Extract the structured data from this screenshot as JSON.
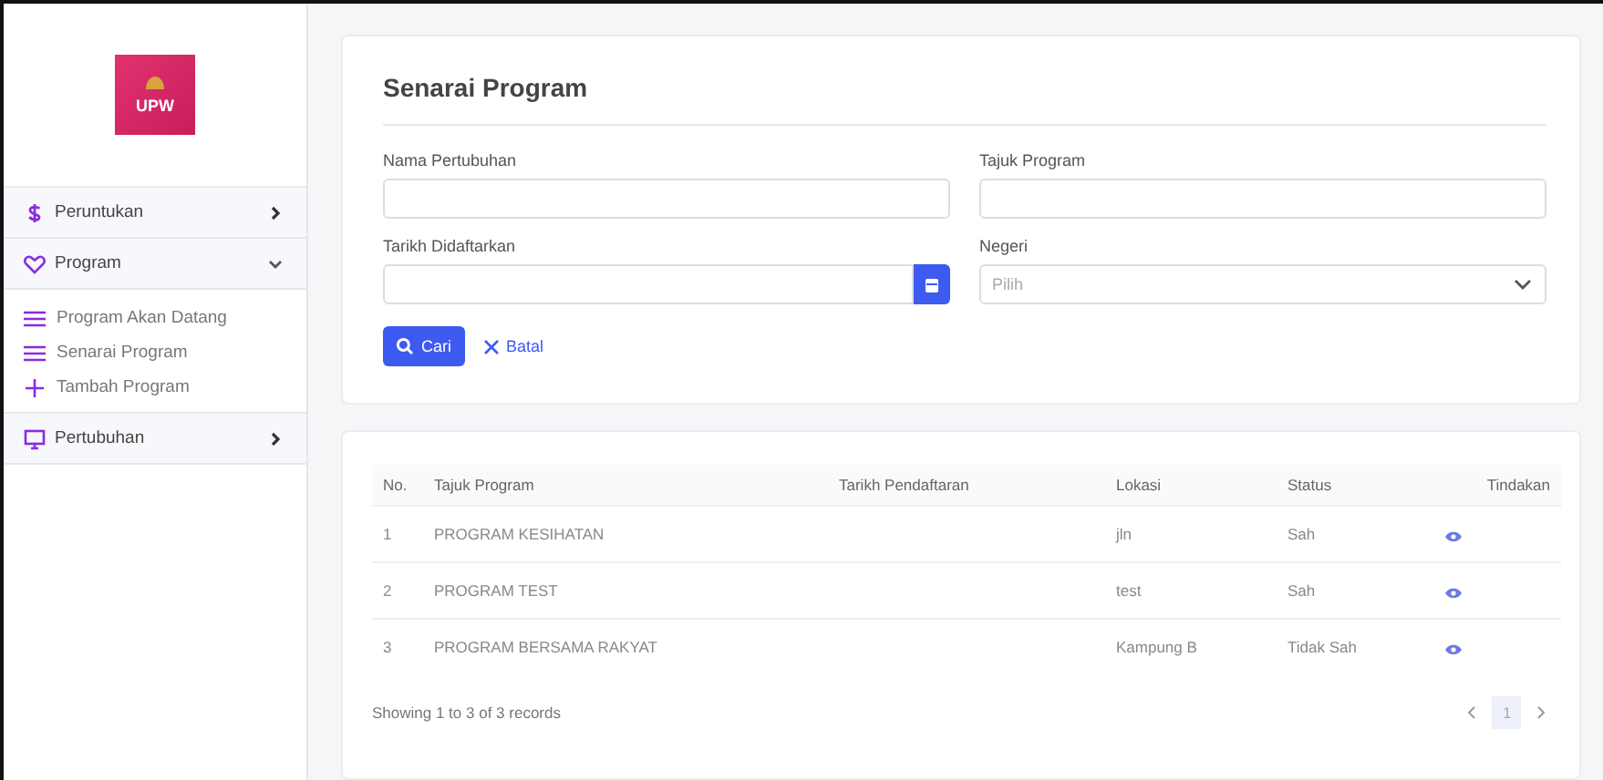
{
  "logo": {
    "text": "UPW"
  },
  "sidebar": {
    "items": [
      {
        "kind": "section",
        "label": "Peruntukan",
        "expanded": false
      },
      {
        "kind": "section",
        "label": "Program",
        "expanded": true,
        "children": [
          {
            "label": "Program Akan Datang"
          },
          {
            "label": "Senarai Program"
          },
          {
            "label": "Tambah Program"
          }
        ]
      },
      {
        "kind": "section",
        "label": "Pertubuhan",
        "expanded": false
      }
    ]
  },
  "search_card": {
    "title": "Senarai Program",
    "fields": [
      {
        "kind": "text",
        "label": "Nama Pertubuhan"
      },
      {
        "kind": "text",
        "label": "Tajuk Program"
      },
      {
        "kind": "date",
        "label": "Tarikh Didaftarkan"
      },
      {
        "kind": "select",
        "label": "Negeri",
        "placeholder": "Pilih"
      }
    ],
    "search_button": "Cari",
    "cancel_link": "Batal"
  },
  "table": {
    "columns": [
      "No.",
      "Tajuk Program",
      "Tarikh Pendaftaran",
      "Lokasi",
      "Status",
      "Tindakan"
    ],
    "rows": [
      [
        "1",
        "PROGRAM KESIHATAN",
        "",
        "jln",
        "Sah"
      ],
      [
        "2",
        "PROGRAM TEST",
        "",
        "test",
        "Sah"
      ],
      [
        "3",
        "PROGRAM BERSAMA RAKYAT",
        "",
        "Kampung B",
        "Tidak Sah"
      ]
    ],
    "footer": "Showing 1 to 3 of 3 records",
    "pages": [
      {
        "label": "1",
        "selected": true
      }
    ]
  }
}
